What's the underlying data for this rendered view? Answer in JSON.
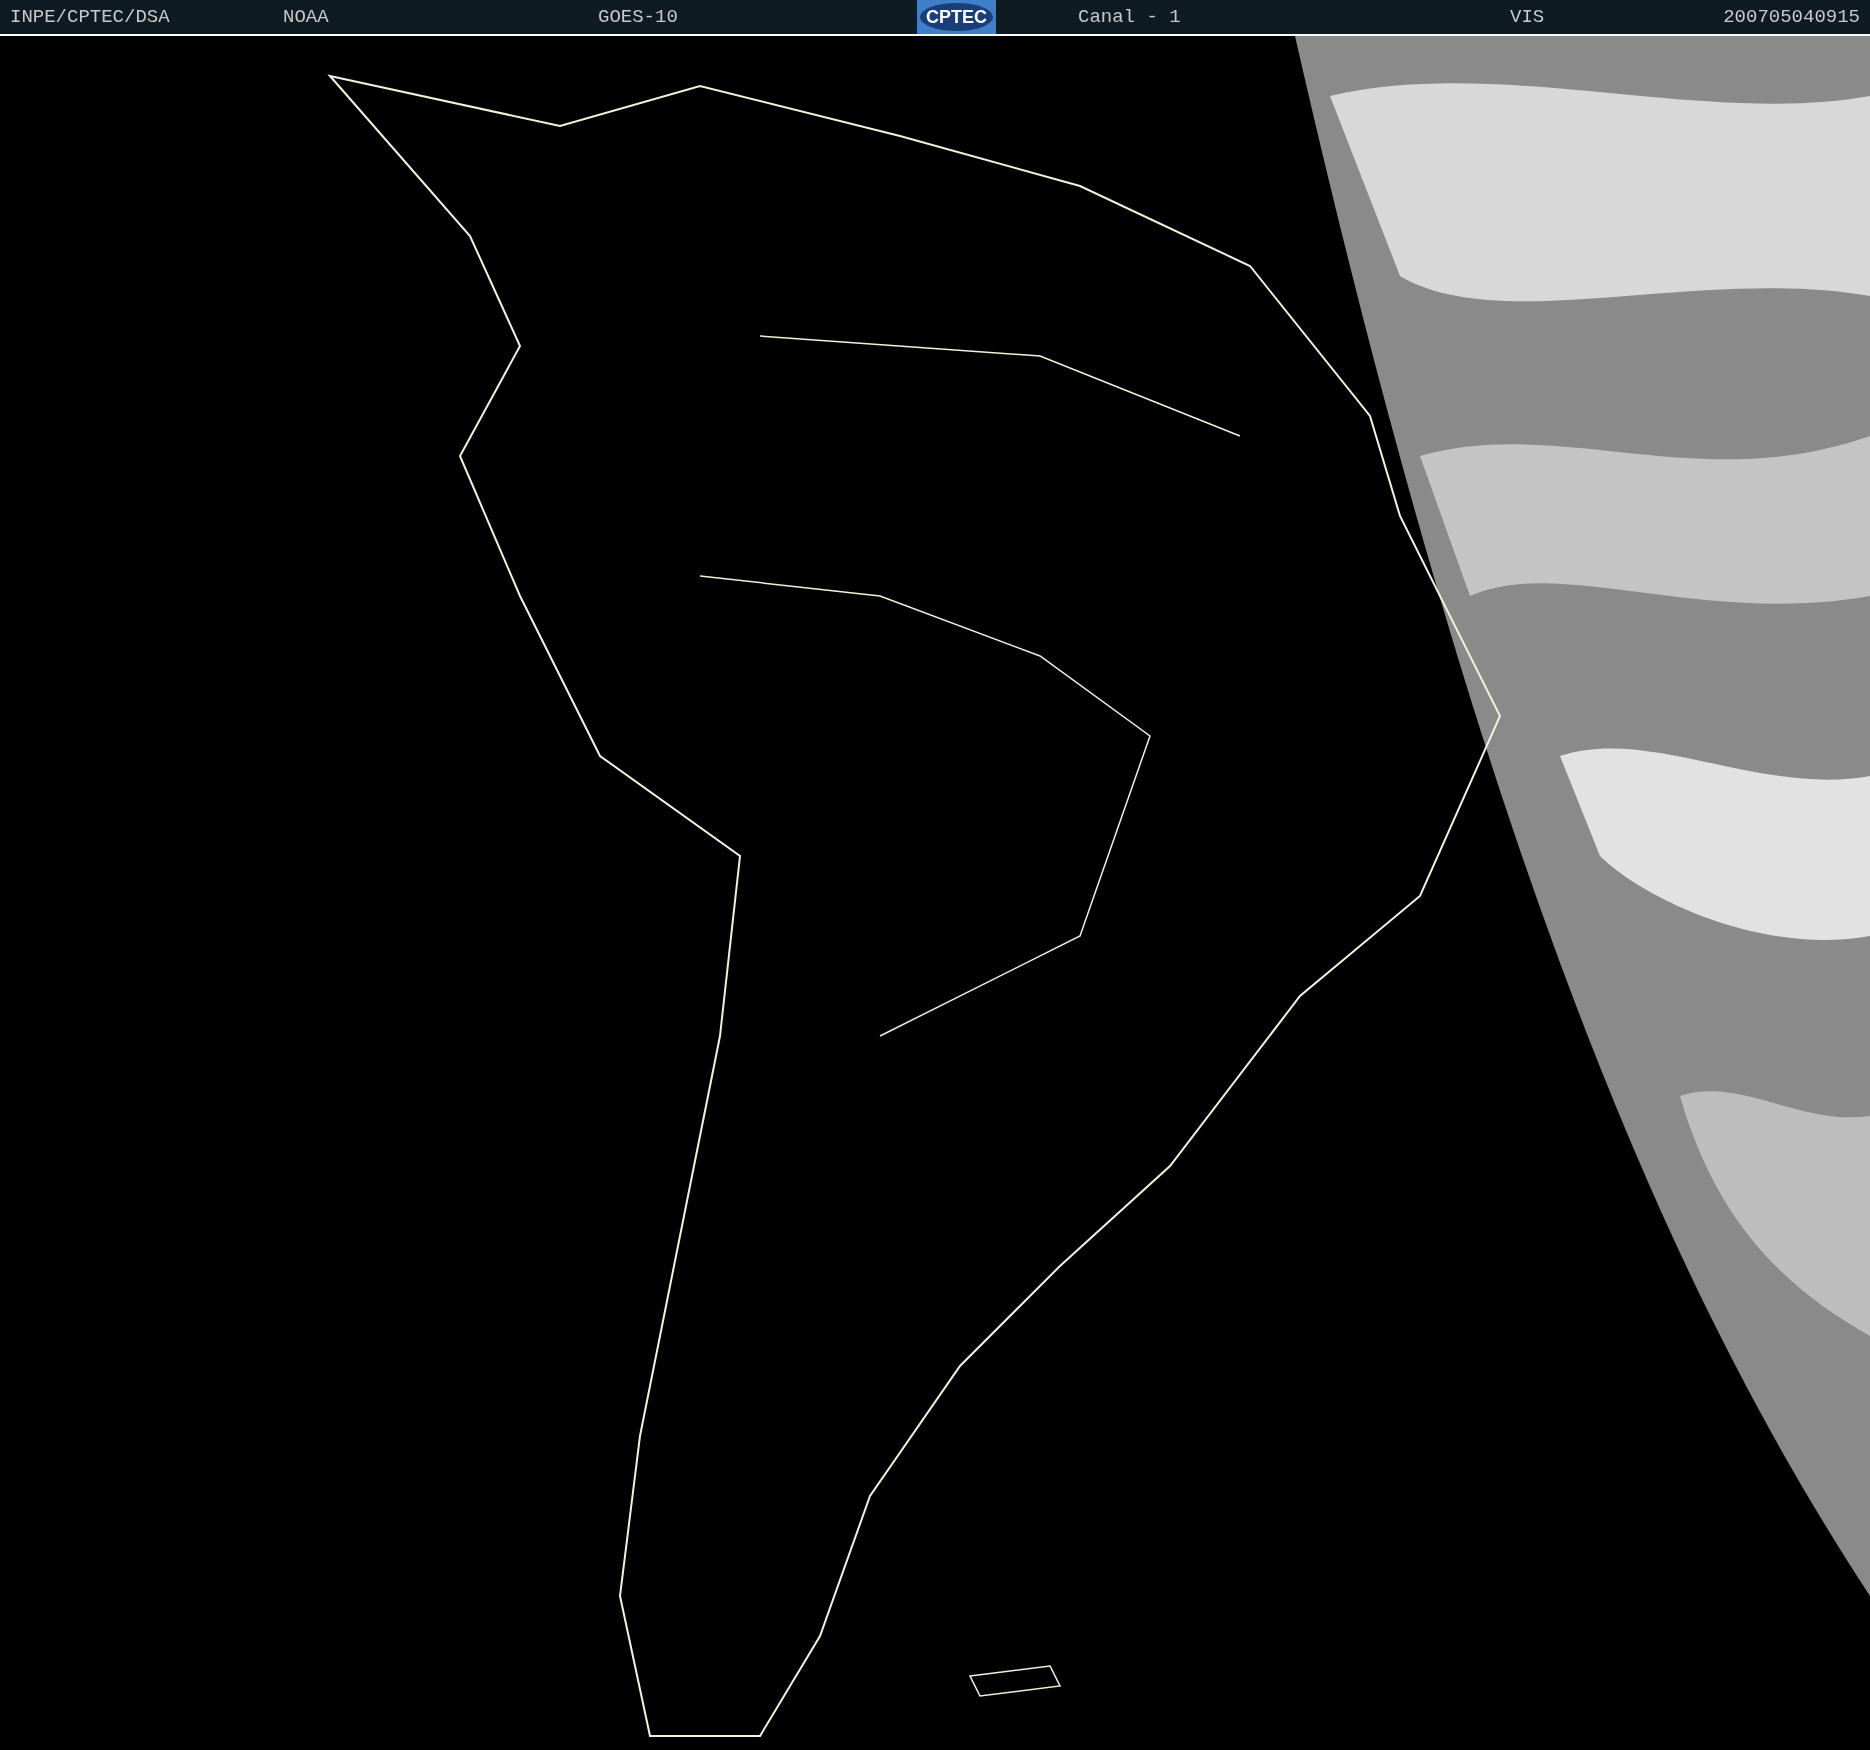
{
  "header": {
    "source": "INPE/CPTEC/DSA",
    "agency": "NOAA",
    "satellite": "GOES-10",
    "logo_text": "CPTEC",
    "channel": "Canal - 1",
    "band": "VIS",
    "timestamp": "200705040915"
  }
}
